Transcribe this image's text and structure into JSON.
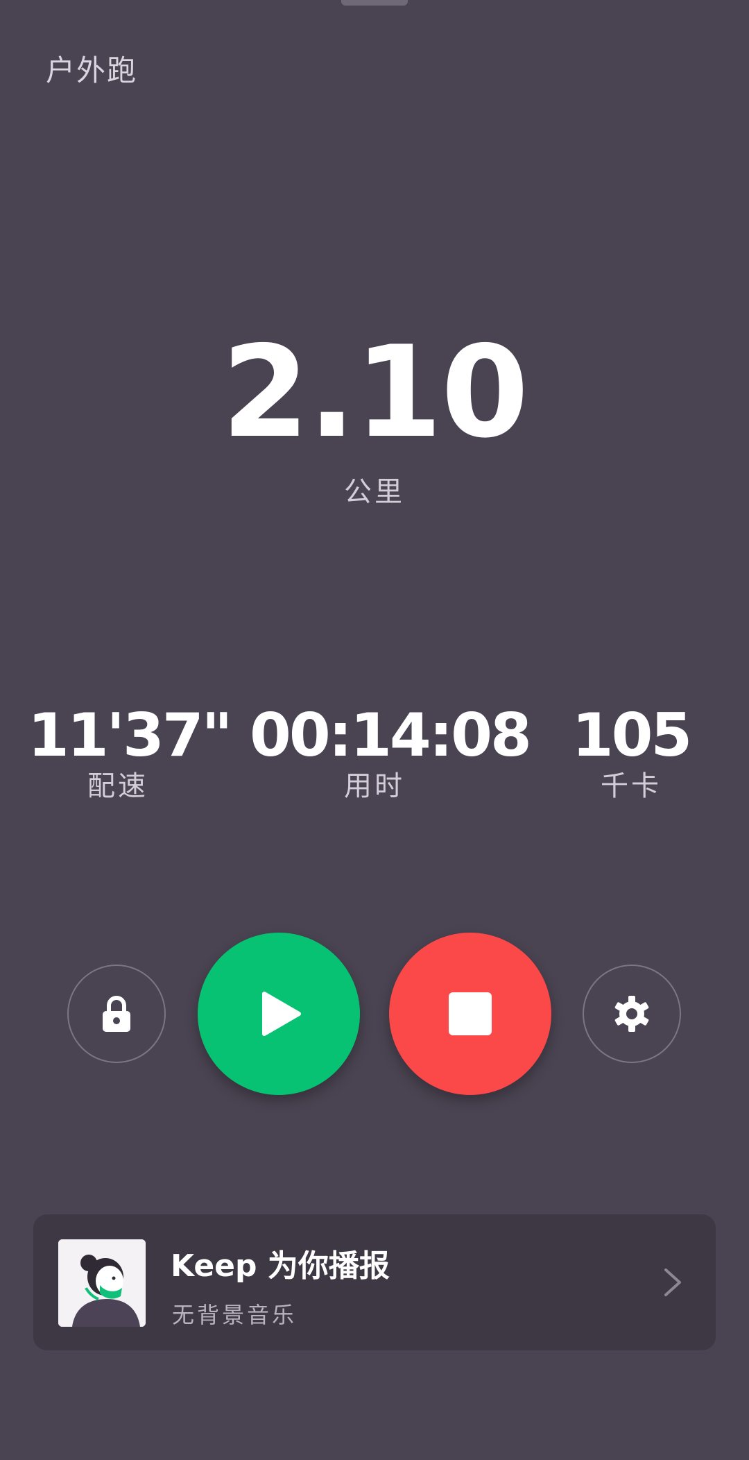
{
  "header": {
    "mode_title": "户外跑"
  },
  "distance": {
    "value": "2.10",
    "unit": "公里"
  },
  "stats": {
    "pace": {
      "value": "11'37\"",
      "label": "配速"
    },
    "duration": {
      "value": "00:14:08",
      "label": "用时"
    },
    "calories": {
      "value": "105",
      "label": "千卡"
    }
  },
  "controls": {
    "lock_icon": "lock-icon",
    "resume_icon": "play-icon",
    "stop_icon": "stop-icon",
    "settings_icon": "gear-icon",
    "resume_color": "#08c274",
    "stop_color": "#fb4849"
  },
  "voice_card": {
    "title": "Keep 为你播报",
    "subtitle": "无背景音乐",
    "avatar_icon": "coach-avatar",
    "chevron_icon": "chevron-right-icon"
  },
  "colors": {
    "background": "#4a4351",
    "card": "#3e3845"
  }
}
